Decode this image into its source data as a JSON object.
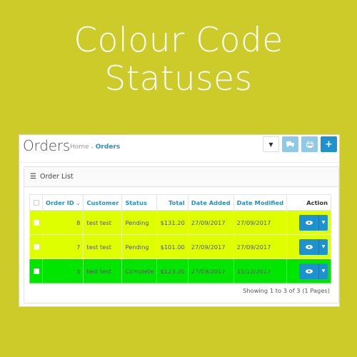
{
  "hero": {
    "line1": "Colour Code",
    "line2": "Statuses"
  },
  "header": {
    "title": "Orders",
    "breadcrumb": [
      {
        "label": "Home"
      },
      {
        "label": "Orders"
      }
    ],
    "breadcrumb_separator": "›",
    "toolbar": {
      "filter_icon": "▼",
      "ship_icon": "🚚",
      "print_icon": "⎙",
      "add_icon": "+"
    }
  },
  "panel": {
    "heading_icon": "☰",
    "heading": "Order List"
  },
  "table": {
    "columns": {
      "order_id": "Order ID",
      "sort_indicator": "⌄",
      "customer": "Customer",
      "status": "Status",
      "total": "Total",
      "date_added": "Date Added",
      "date_modified": "Date Modified",
      "action": "Action"
    },
    "rows": [
      {
        "order_id": "8",
        "customer": "test test",
        "status": "Pending",
        "total": "$131.20",
        "date_added": "27/09/2017",
        "date_modified": "27/09/2017",
        "row_color": "#deff00"
      },
      {
        "order_id": "7",
        "customer": "test test",
        "status": "Pending",
        "total": "$101.00",
        "date_added": "27/09/2017",
        "date_modified": "27/09/2017",
        "row_color": "#deff00"
      },
      {
        "order_id": "5",
        "customer": "test test",
        "status": "Complete",
        "total": "$123.20",
        "date_added": "27/09/2017",
        "date_modified": "15/12/2017",
        "row_color": "#00e600"
      }
    ],
    "action_view_icon": "👁",
    "action_dropdown_icon": "▼"
  },
  "pagination": {
    "text": "Showing 1 to 3 of 3 (1 Pages)"
  },
  "colors": {
    "background": "#cdcb2a",
    "accent": "#1e91cf",
    "pending": "#deff00",
    "complete": "#00e600"
  }
}
